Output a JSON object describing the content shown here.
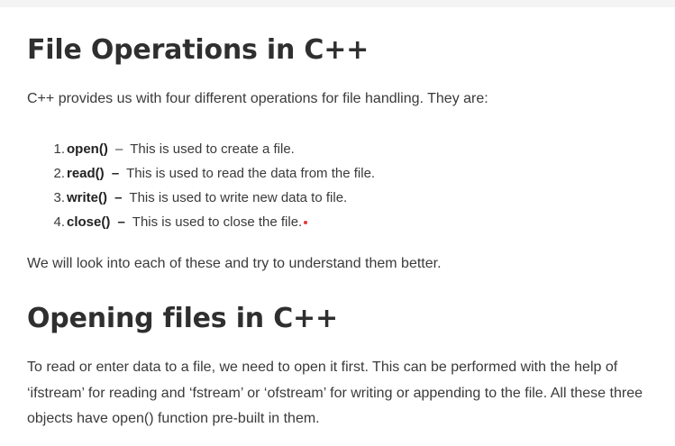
{
  "section1": {
    "title": "File Operations in C++",
    "intro": "C++ provides us with four different operations for file handling. They are:",
    "items": [
      {
        "num": "1.",
        "fn": "open()",
        "dash": "–",
        "desc": "This is used to create a file."
      },
      {
        "num": "2.",
        "fn": "read()",
        "dash": "–",
        "desc": "This is used to read the data from the file."
      },
      {
        "num": "3.",
        "fn": "write()",
        "dash": "–",
        "desc": "This is used to write new data to file."
      },
      {
        "num": "4.",
        "fn": "close()",
        "dash": "–",
        "desc": "This is used to close the file."
      }
    ],
    "followup": "We will look into each of these and try to understand them better."
  },
  "section2": {
    "title": "Opening files in C++",
    "paragraph": "To read or enter data to a file, we need to open it first. This can be performed with the help of ‘ifstream’ for reading and ‘fstream’ or ‘ofstream’ for writing or appending to the file. All these three objects have open() function pre-built in them."
  },
  "colors": {
    "text": "#3a3a3a",
    "heading": "#2f2f2f",
    "accent_dot": "#e53935"
  }
}
